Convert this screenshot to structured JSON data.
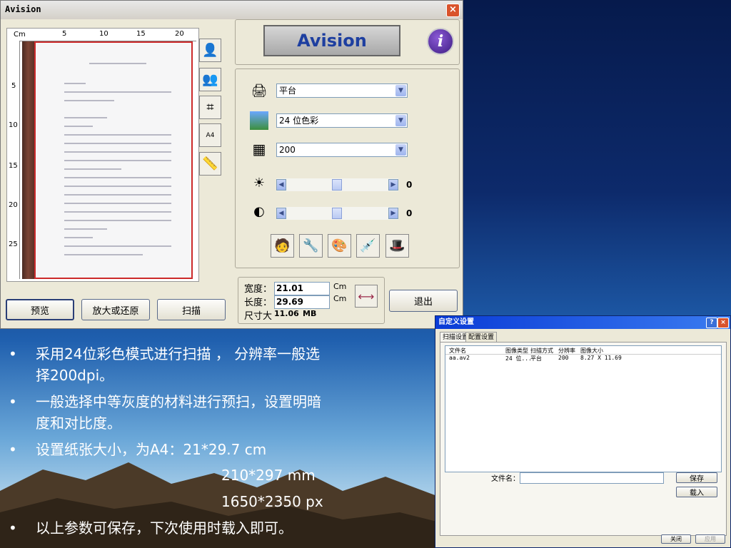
{
  "window": {
    "title": "Avision",
    "close": "×",
    "logo": "Avision",
    "info": "i"
  },
  "ruler": {
    "unit": "Cm",
    "h_ticks": [
      "5",
      "10",
      "15",
      "20"
    ],
    "v_ticks": [
      "5",
      "10",
      "15",
      "20",
      "25"
    ]
  },
  "scan_settings": {
    "scan_source": "平台",
    "color_mode": "24 位色彩",
    "resolution": "200",
    "brightness": "0",
    "contrast": "0"
  },
  "paper": {
    "width_label": "宽度：",
    "width_value": "21.01",
    "width_unit": "Cm",
    "length_label": "长度：",
    "length_value": "29.69",
    "length_unit": "Cm",
    "size_label": "尺寸大",
    "size_value": "11.06",
    "size_unit": "MB"
  },
  "buttons": {
    "preview": "预览",
    "zoom": "放大或还原",
    "scan": "扫描",
    "exit": "退出"
  },
  "dialog": {
    "title": "自定义设置",
    "help": "?",
    "close": "×",
    "tabs": [
      "扫描设置",
      "配置设置"
    ],
    "columns": [
      "文件名",
      "图像类型",
      "扫描方式",
      "分辨率",
      "图像大小"
    ],
    "row": [
      "aa.av2",
      "24 位...",
      "平台",
      "200",
      "8.27 X 11.69"
    ],
    "filename_label": "文件名：",
    "filename_value": "",
    "save": "保存",
    "load": "载入",
    "close_btn": "关闭",
    "apply_btn": "应用"
  },
  "bullets": [
    {
      "line1": "采用24位彩色模式进行扫描 ， 分辨率一般选",
      "line2": "择200dpi。"
    },
    {
      "line1": "一般选择中等灰度的材料进行预扫，设置明暗",
      "line2": "度和对比度。"
    },
    {
      "line1": "设置纸张大小，为A4：21*29.7 cm",
      "line2": "210*297 mm",
      "line3": "1650*2350 px"
    },
    {
      "line1": "以上参数可保存，下次使用时载入即可。"
    }
  ],
  "bullet_mark": "•"
}
